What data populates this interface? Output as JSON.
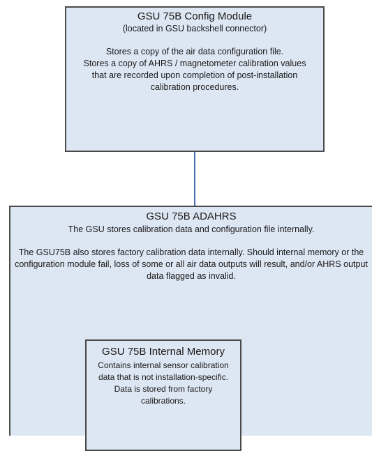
{
  "config_module": {
    "title": "GSU 75B Config Module",
    "location": "(located in GSU backshell connector)",
    "description_1": "Stores a copy of the air data configuration file.",
    "description_2": "Stores a copy of AHRS / magnetometer calibration values that are recorded upon completion of post-installation calibration procedures."
  },
  "adahrs": {
    "title": "GSU 75B ADAHRS",
    "description_1": "The GSU stores calibration data and configuration file internally.",
    "description_2": "The GSU75B also stores factory calibration data internally. Should internal memory or the configuration module fail, loss of some or all air data outputs will result, and/or AHRS output data flagged as invalid."
  },
  "internal_memory": {
    "title": "GSU 75B Internal Memory",
    "description": "Contains internal sensor calibration data that is not installation-specific.  Data is stored from factory calibrations."
  },
  "colors": {
    "box_fill": "#dde6f3",
    "box_border": "#4a4a4a",
    "connector": "#4a6fb0"
  }
}
